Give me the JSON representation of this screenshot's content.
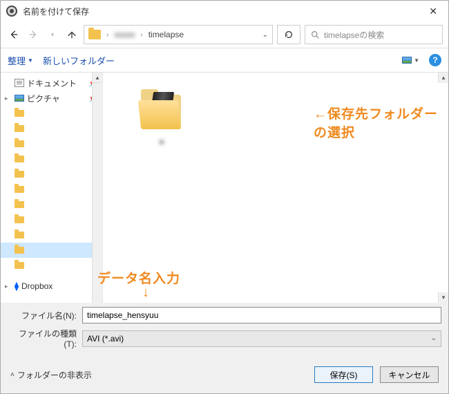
{
  "window": {
    "title": "名前を付けて保存"
  },
  "nav": {
    "addressbar_label": "timelapse",
    "search_placeholder": "timelapseの検索"
  },
  "toolbar": {
    "organize_label": "整理",
    "newfolder_label": "新しいフォルダー"
  },
  "sidebar": {
    "items": [
      {
        "label": "ドキュメント"
      },
      {
        "label": "ピクチャ"
      },
      {
        "label": "       "
      },
      {
        "label": "       "
      },
      {
        "label": "       "
      },
      {
        "label": "       "
      },
      {
        "label": "       "
      },
      {
        "label": "       "
      },
      {
        "label": "       "
      },
      {
        "label": "       "
      },
      {
        "label": "       "
      },
      {
        "label": "       "
      },
      {
        "label": "       "
      },
      {
        "label": "Dropbox"
      }
    ]
  },
  "annotations": {
    "select_folder": "←保存先フォルダーの選択",
    "data_name": "データ名入力",
    "arrow_down": "↓"
  },
  "fields": {
    "filename_label": "ファイル名(N):",
    "filename_value": "timelapse_hensyuu",
    "filetype_label": "ファイルの種類(T):",
    "filetype_value": "AVI (*.avi)"
  },
  "footer": {
    "hide_folders": "フォルダーの非表示",
    "save_label": "保存(S)",
    "cancel_label": "キャンセル"
  }
}
